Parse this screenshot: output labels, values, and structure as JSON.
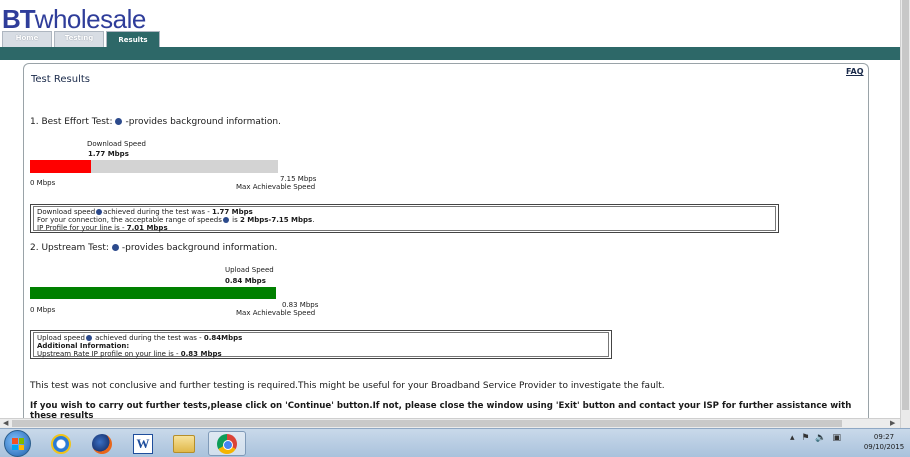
{
  "header": {
    "logo_bt": "BT",
    "logo_rest": "wholesale",
    "tabs": [
      {
        "label": "Home",
        "active": false
      },
      {
        "label": "Testing",
        "active": false
      },
      {
        "label": "Results",
        "active": true
      }
    ],
    "accent_color": "#2d6868"
  },
  "page": {
    "title": "Test Results",
    "faq_link": "FAQ"
  },
  "best_effort": {
    "heading_prefix": "1. Best Effort Test:",
    "heading_suffix": "-provides background information.",
    "caption_label": "Download  Speed",
    "caption_value": "1.77 Mbps",
    "min_label": "0 Mbps",
    "max_value_label": "7.15 Mbps",
    "max_label": "Max Achievable Speed",
    "fill_fraction": 0.2476,
    "fill_color": "#ff0000",
    "info": {
      "line1_prefix": "Download speed",
      "line1_mid": "achieved during the test was - ",
      "line1_value": "1.77 Mbps",
      "line2_prefix": "For your connection, the acceptable range of speeds",
      "line2_mid": " is ",
      "line2_value": "2 Mbps-7.15 Mbps",
      "line2_end": ".",
      "line3_prefix": "IP Profile for your line is - ",
      "line3_value": "7.01 Mbps"
    }
  },
  "upstream": {
    "heading_prefix": "2. Upstream Test:",
    "heading_suffix": "-provides background information.",
    "caption_label": "Upload Speed",
    "caption_value": "0.84 Mbps",
    "min_label": "0 Mbps",
    "max_value_label": "0.83 Mbps",
    "max_label": "Max Achievable Speed",
    "fill_fraction": 1.0,
    "fill_color": "#008000",
    "info": {
      "line1_prefix": "Upload speed",
      "line1_mid": " achieved during the test was - ",
      "line1_value": "0.84Mbps",
      "line2": "Additional Information:",
      "line3_prefix": "Upstream Rate IP profile on your line is - ",
      "line3_value": "0.83 Mbps"
    }
  },
  "messages": {
    "inconclusive": "This test was not conclusive and further testing is required.This might be useful for your Broadband Service Provider to investigate the fault.",
    "instructions": "If you wish to carry out further tests,please click on 'Continue' button.If not, please close the window using 'Exit' button and contact your ISP for further assistance with",
    "instructions_cont": "these results"
  },
  "taskbar": {
    "apps": [
      "start-button",
      "internet-explorer",
      "firefox",
      "word",
      "file-explorer",
      "chrome"
    ],
    "active_app": "chrome",
    "time": "09:27",
    "date": "09/10/2015"
  }
}
